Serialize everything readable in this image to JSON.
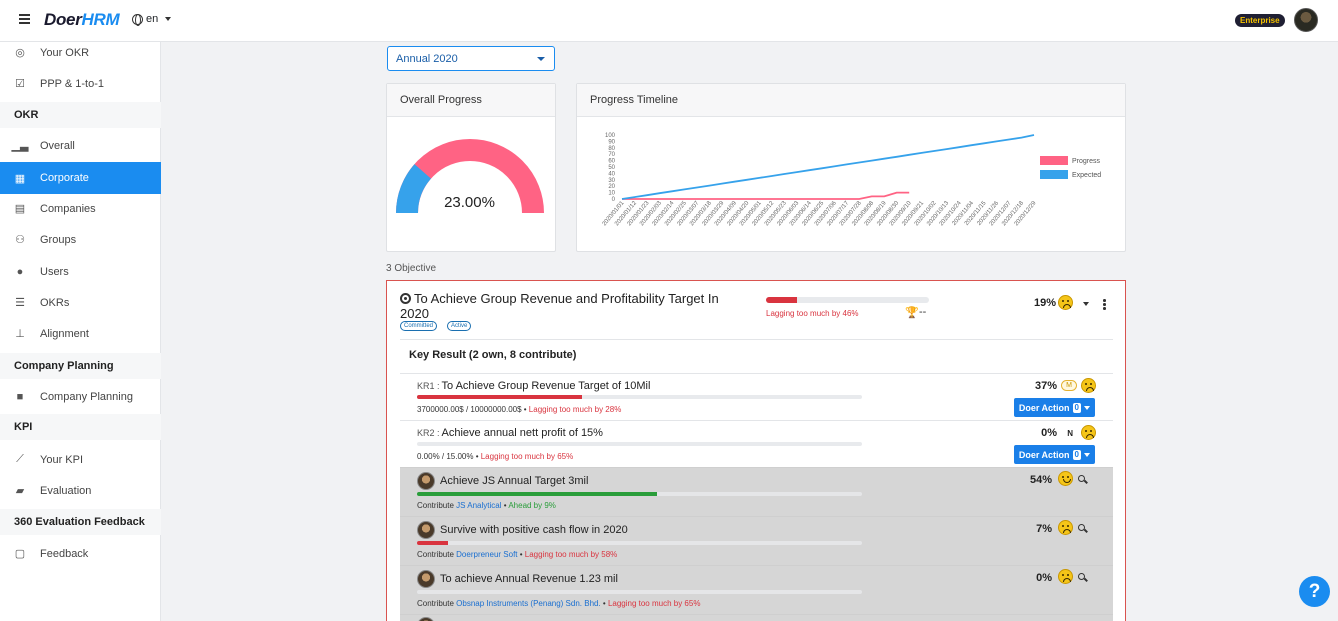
{
  "app": {
    "logo_doer": "Doer",
    "logo_hrm": "HRM",
    "language": "en",
    "plan_badge": "Enterprise"
  },
  "sidebar": {
    "items": [
      {
        "label": "Your OKR",
        "icon": "target-icon"
      },
      {
        "label": "PPP & 1-to-1",
        "icon": "calendar-check-icon"
      },
      {
        "label": "Overall",
        "icon": "bar-chart-icon"
      },
      {
        "label": "Corporate",
        "icon": "building-icon",
        "active": true
      },
      {
        "label": "Companies",
        "icon": "office-building-icon"
      },
      {
        "label": "Groups",
        "icon": "users-icon"
      },
      {
        "label": "Users",
        "icon": "user-icon"
      },
      {
        "label": "OKRs",
        "icon": "list-icon"
      },
      {
        "label": "Alignment",
        "icon": "sitemap-icon"
      },
      {
        "label": "Company Planning",
        "icon": "note-icon"
      },
      {
        "label": "Your KPI",
        "icon": "line-chart-icon"
      },
      {
        "label": "Evaluation",
        "icon": "book-icon"
      },
      {
        "label": "Feedback",
        "icon": "comment-icon"
      }
    ],
    "headings": [
      "OKR",
      "Company Planning",
      "KPI",
      "360 Evaluation Feedback"
    ]
  },
  "filters": {
    "period": "Annual 2020"
  },
  "overall_progress": {
    "title": "Overall Progress",
    "value_text": "23.00%",
    "value": 0.23
  },
  "timeline": {
    "title": "Progress Timeline",
    "legend": [
      "Progress",
      "Expected"
    ],
    "colors": {
      "progress": "#ff6384",
      "expected": "#36a2eb"
    }
  },
  "chart_data": {
    "type": "line",
    "title": "",
    "x": [
      "2020/01/01",
      "2020/01/12",
      "2020/01/23",
      "2020/02/03",
      "2020/02/14",
      "2020/02/25",
      "2020/03/07",
      "2020/03/18",
      "2020/03/29",
      "2020/04/09",
      "2020/04/20",
      "2020/05/01",
      "2020/05/12",
      "2020/05/23",
      "2020/06/03",
      "2020/06/14",
      "2020/06/25",
      "2020/07/06",
      "2020/07/17",
      "2020/07/28",
      "2020/08/08",
      "2020/08/19",
      "2020/08/30",
      "2020/09/10",
      "2020/09/21",
      "2020/10/02",
      "2020/10/13",
      "2020/10/24",
      "2020/11/04",
      "2020/11/15",
      "2020/11/26",
      "2020/12/07",
      "2020/12/18",
      "2020/12/29"
    ],
    "series": [
      {
        "name": "Progress",
        "values": [
          0,
          0,
          0,
          0,
          0,
          0,
          0,
          0,
          0,
          0,
          0,
          0,
          0,
          0,
          0,
          0,
          0,
          0,
          0,
          0,
          4,
          4,
          10,
          10
        ]
      },
      {
        "name": "Expected",
        "values": [
          0,
          3,
          6,
          9,
          12,
          15,
          18,
          21,
          24,
          27,
          30,
          33,
          36,
          39,
          42,
          45,
          48,
          51,
          54,
          57,
          60,
          63,
          66,
          69,
          72,
          75,
          78,
          81,
          84,
          87,
          90,
          93,
          96,
          100
        ]
      }
    ],
    "ylim": [
      0,
      100
    ],
    "legend_position": "right"
  },
  "objectives": {
    "count_label": "3 Objective",
    "main": {
      "title": "To Achieve Group Revenue and Profitability Target In 2020",
      "tags": [
        "Committed",
        "Active"
      ],
      "progress": 0.19,
      "progress_text": "19%",
      "status": "Lagging too much by 46%",
      "trophy_text": "--",
      "key_result_heading": "Key Result (2 own, 8 contribute)",
      "key_results": [
        {
          "id": "KR1 :",
          "title": "To Achieve Group Revenue Target of 10Mil",
          "progress": 0.37,
          "pct": "37%",
          "flag": "M",
          "meta": "3700000.00$ / 10000000.00$",
          "status": "Lagging too much by 28%",
          "mood": "sad",
          "action": "Doer Action",
          "action_count": "0"
        },
        {
          "id": "KR2 :",
          "title": "Achieve annual nett profit of 15%",
          "progress": 0.0,
          "pct": "0%",
          "flag": "N",
          "meta": "0.00% / 15.00%",
          "status": "Lagging too much by 65%",
          "mood": "sad",
          "action": "Doer Action",
          "action_count": "0"
        }
      ],
      "contributions": [
        {
          "title": "Achieve JS Annual Target 3mil",
          "progress": 0.54,
          "pct": "54%",
          "prefix": "Contribute",
          "org": "JS Analytical",
          "status": "Ahead by 9%",
          "mood": "happy",
          "color": "#2a9d3a"
        },
        {
          "title": "Survive with positive cash flow in 2020",
          "progress": 0.07,
          "pct": "7%",
          "prefix": "Contribute",
          "org": "Doerpreneur Soft",
          "status": "Lagging too much by 58%",
          "mood": "sad",
          "color": "#d9343f"
        },
        {
          "title": "To achieve Annual Revenue 1.23 mil",
          "progress": 0.0,
          "pct": "0%",
          "prefix": "Contribute",
          "org": "Obsnap Instruments (Penang) Sdn. Bhd.",
          "status": "Lagging too much by 65%",
          "mood": "sad",
          "color": "#d9343f"
        }
      ]
    }
  },
  "help": {
    "label": "?"
  }
}
